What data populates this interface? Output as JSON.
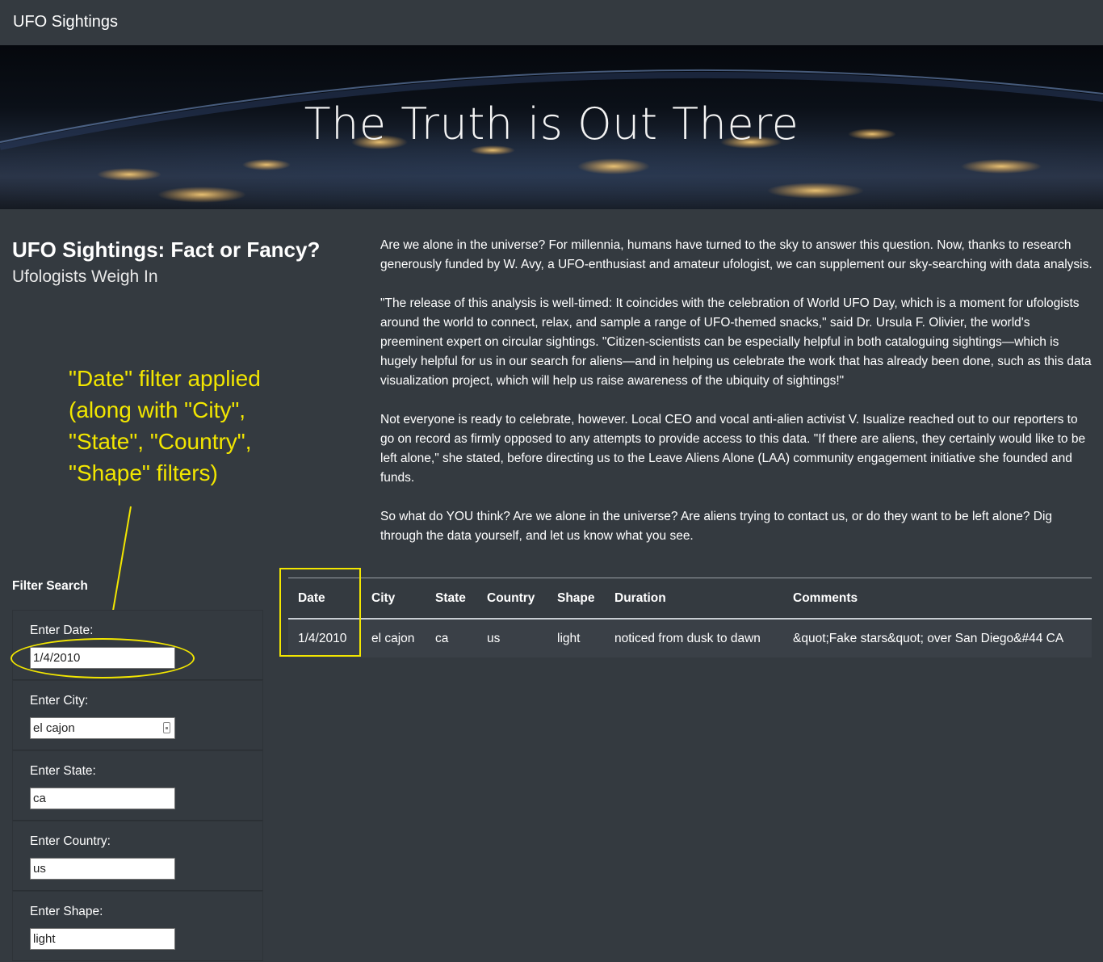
{
  "nav": {
    "brand": "UFO Sightings"
  },
  "hero": {
    "title": "The Truth is Out There"
  },
  "article": {
    "headline": "UFO Sightings: Fact or Fancy?",
    "subhead": "Ufologists Weigh In",
    "paragraphs": [
      "Are we alone in the universe? For millennia, humans have turned to the sky to answer this question. Now, thanks to research generously funded by W. Avy, a UFO-enthusiast and amateur ufologist, we can supplement our sky-searching with data analysis.",
      "\"The release of this analysis is well-timed: It coincides with the celebration of World UFO Day, which is a moment for ufologists around the world to connect, relax, and sample a range of UFO-themed snacks,\" said Dr. Ursula F. Olivier, the world's preeminent expert on circular sightings. \"Citizen-scientists can be especially helpful in both cataloguing sightings—which is hugely helpful for us in our search for aliens—and in helping us celebrate the work that has already been done, such as this data visualization project, which will help us raise awareness of the ubiquity of sightings!\"",
      "Not everyone is ready to celebrate, however. Local CEO and vocal anti-alien activist V. Isualize reached out to our reporters to go on record as firmly opposed to any attempts to provide access to this data. \"If there are aliens, they certainly would like to be left alone,\" she stated, before directing us to the Leave Aliens Alone (LAA) community engagement initiative she founded and funds.",
      "So what do YOU think? Are we alone in the universe? Are aliens trying to contact us, or do they want to be left alone? Dig through the data yourself, and let us know what you see."
    ]
  },
  "annotation": {
    "lines": [
      "\"Date\" filter applied",
      "(along with \"City\",",
      "\"State\", \"Country\",",
      "\"Shape\" filters)"
    ],
    "color": "#f2e600"
  },
  "filters": {
    "title": "Filter Search",
    "items": [
      {
        "label": "Enter Date:",
        "value": "1/4/2010"
      },
      {
        "label": "Enter City:",
        "value": "el cajon"
      },
      {
        "label": "Enter State:",
        "value": "ca"
      },
      {
        "label": "Enter Country:",
        "value": "us"
      },
      {
        "label": "Enter Shape:",
        "value": "light"
      }
    ]
  },
  "table": {
    "headers": [
      "Date",
      "City",
      "State",
      "Country",
      "Shape",
      "Duration",
      "Comments"
    ],
    "rows": [
      [
        "1/4/2010",
        "el cajon",
        "ca",
        "us",
        "light",
        "noticed from dusk to dawn",
        "&quot;Fake stars&quot; over San Diego&#44 CA"
      ]
    ]
  }
}
